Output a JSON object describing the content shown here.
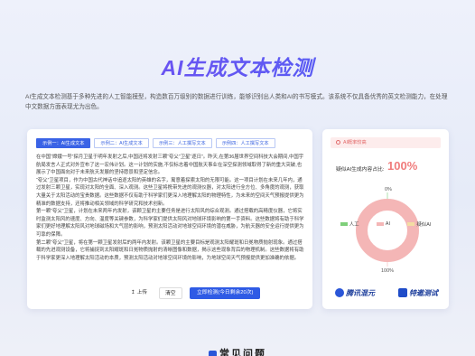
{
  "page": {
    "title": "AI生成文本检测",
    "description": "AI生成文本检测基于多种先进的人工智能模型，构造数百万级别的数据进行训练，能够识别出人类和AI的书写模式。该系统不仅具备优秀的英文检测能力，在处理中文数据方面表现尤为出色。"
  },
  "tabs": [
    {
      "label": "示例一：AI生成文本"
    },
    {
      "label": "示例二：AI生成文本"
    },
    {
      "label": "示例三：人工撰写文本"
    },
    {
      "label": "示例四：人工撰写文本"
    }
  ],
  "article": {
    "paragraphs": [
      "在中国“嫦娥一号”探月卫星于明年发射之后,中国还将发射三颗“夸父”卫星“逐日”。昨天,在第36届世界空间科技大会期间,中国宇航局发言人正式对外宣布了这一宏伟计划。这一计划的实施,不仅标志着中国航天事业在深空探测领域取得了新的重大突破,也展示了中国面向对于未来航天发展的坚持愿景和坚定信念。",
      "“夸父”卫星项目，作为中国古代神话中追逐太阳的英雄的名字，寓意着探索太阳的无限可能。这一项目计划在未来几年内，通过发射三颗卫星，实现对太阳的全面、深入观测。这些卫星将携带先进的观测仪器，对太阳进行全方位、多角度的观测，获取大量关于太阳活动的宝贵数据。这些数据不仅有助于科学家们更深入地理解太阳的物理特性，为未来的空间天气预报提供更为精准的数据支持，还将推动相关领域的科学研究和技术创新。",
      "第一颗“夸父”卫星，计划在未来两年内发射，该颗卫星的主要任务是进行太阳风的综合观测。通过搭载的高精度仪器，它将实时监测太阳风的速度、方向、温度等关键参数，为科学家们提供太阳风对地球环境影响的第一手资料。这些数据将有助于科学家们更好地理解太阳风对地球磁场和大气层的影响，预测太阳活动对地球空间环境的潜在威胁，为航天器的安全运行提供更为可靠的保障。",
      "第二颗“夸父”卫星，将在第一颗卫星发射后的两年内发射。该颗卫星的主要目标是观测太阳耀斑和日冕物质抛射现象。通过搭载的先进观测设备，它将捕捉到太阳耀斑和日冕物质抛射的清晰图像和数据，揭示这些现象背后的物理机制。这些数据将有助于科学家更深入地理解太阳活动的本质，预测太阳活动对地球空间环境的影响，为地球空间天气预报提供更加准确的依据。"
    ]
  },
  "actions": {
    "upload_label": "↥ 上传",
    "clear_label": "清空",
    "detect_label": "立即检测(今日剩余20次)"
  },
  "result": {
    "alert_text": "AI概率较高",
    "probability_label": "疑似AI生成内容占比:",
    "probability_value": "100%",
    "chart_data": {
      "type": "pie",
      "categories": [
        "人工",
        "AI",
        "疑似AI"
      ],
      "values": [
        0,
        100,
        0
      ],
      "labels": [
        "0%",
        "100%"
      ]
    },
    "colors": {
      "human": "#7fcf7a",
      "ai": "#f4b6b6",
      "suspect": "#f3dda3"
    }
  },
  "logos": [
    {
      "name": "腾讯混元",
      "icon": "tencent-hunyuan-logo"
    },
    {
      "name": "特邀测试",
      "icon": "invited-test-logo"
    }
  ],
  "bottom": {
    "heading": "常见问题"
  }
}
